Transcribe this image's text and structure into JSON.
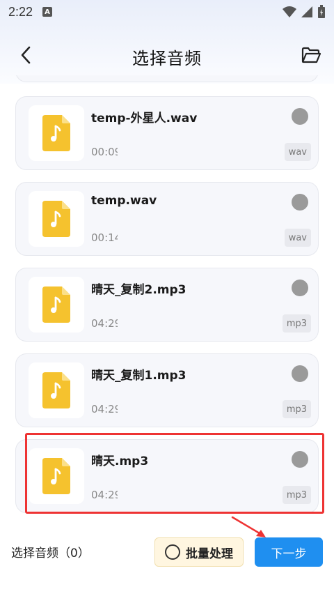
{
  "status_bar": {
    "time": "2:22",
    "notif_letter": "A"
  },
  "header": {
    "title": "选择音频"
  },
  "files": [
    {
      "name": "temp-外星人.wav",
      "duration": "00:09",
      "ext": "wav"
    },
    {
      "name": "temp.wav",
      "duration": "00:14",
      "ext": "wav"
    },
    {
      "name": "晴天_复制2.mp3",
      "duration": "04:29",
      "ext": "mp3"
    },
    {
      "name": "晴天_复制1.mp3",
      "duration": "04:29",
      "ext": "mp3"
    },
    {
      "name": "晴天.mp3",
      "duration": "04:29",
      "ext": "mp3"
    }
  ],
  "footer": {
    "selected_label": "选择音频（0）",
    "batch_label": "批量处理",
    "next_label": "下一步"
  },
  "colors": {
    "accent": "#1f8ff0",
    "highlight": "#e33333",
    "file_icon": "#f5c22e"
  }
}
